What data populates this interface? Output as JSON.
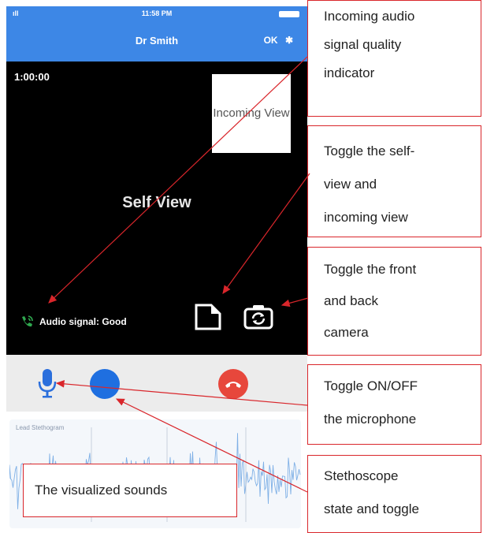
{
  "status_bar": {
    "signal": "ıll",
    "time": "11:58 PM"
  },
  "nav": {
    "title": "Dr Smith",
    "right_label": "OK"
  },
  "video": {
    "timer": "1:00:00",
    "incoming_label": "Incoming View",
    "self_label": "Self View",
    "audio_status": "Audio signal: Good"
  },
  "waveform": {
    "label": "Lead Stethogram"
  },
  "callouts": {
    "audio_quality": [
      "Incoming audio",
      "signal quality",
      "indicator"
    ],
    "toggle_views": [
      "Toggle the self-",
      "view and",
      "incoming view"
    ],
    "toggle_camera": [
      "Toggle the front",
      "and back",
      "camera"
    ],
    "toggle_mic": [
      "Toggle ON/OFF",
      "the microphone"
    ],
    "stethoscope": [
      "Stethoscope",
      "state and toggle"
    ],
    "visualized": "The visualized sounds"
  },
  "colors": {
    "header": "#3d87e6",
    "stethoscope": "#1f6fe0",
    "hangup": "#e7473c",
    "callout_border": "#d9262b",
    "audio_icon": "#2fa84f"
  },
  "icons": [
    "phone-audio-icon",
    "toggle-view-icon",
    "camera-flip-icon",
    "microphone-icon",
    "stethoscope-button",
    "hangup-icon"
  ]
}
